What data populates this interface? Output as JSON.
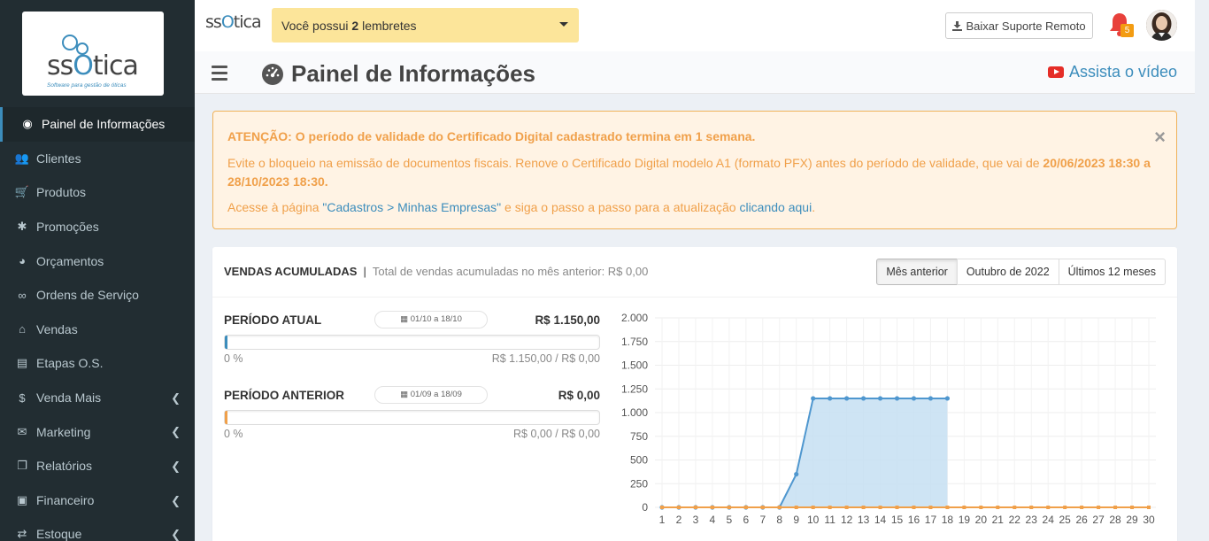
{
  "sidebar": {
    "logo": {
      "text_pre": "ss",
      "text_o": "O",
      "text_post": "tica",
      "tagline": "Software para gestão de óticas"
    },
    "items": [
      {
        "label": "Painel de Informações",
        "icon": "dashboard-icon",
        "active": true
      },
      {
        "label": "Clientes",
        "icon": "users-icon"
      },
      {
        "label": "Produtos",
        "icon": "cart-icon"
      },
      {
        "label": "Promoções",
        "icon": "asterisk-icon"
      },
      {
        "label": "Orçamentos",
        "icon": "user-circle-icon"
      },
      {
        "label": "Ordens de Serviço",
        "icon": "glasses-icon"
      },
      {
        "label": "Vendas",
        "icon": "basket-icon"
      },
      {
        "label": "Etapas O.S.",
        "icon": "list-icon"
      },
      {
        "label": "Venda Mais",
        "icon": "dollar-icon",
        "submenu": true
      },
      {
        "label": "Marketing",
        "icon": "comments-icon",
        "submenu": true
      },
      {
        "label": "Relatórios",
        "icon": "copy-icon",
        "submenu": true
      },
      {
        "label": "Financeiro",
        "icon": "money-icon",
        "submenu": true
      },
      {
        "label": "Estoque",
        "icon": "exchange-icon",
        "submenu": true
      }
    ]
  },
  "topbar": {
    "logo": {
      "text_pre": "ss",
      "text_o": "O",
      "text_post": "tica"
    },
    "reminder": {
      "prefix": "Você possui ",
      "count": "2",
      "suffix": " lembretes"
    },
    "support_button": "Baixar Suporte Remoto",
    "notifications_count": "5"
  },
  "header": {
    "title": "Painel de Informações",
    "video_link": "Assista o vídeo"
  },
  "alert": {
    "title": "ATENÇÃO: O período de validade do Certificado Digital cadastrado termina em 1 semana.",
    "body_prefix": "Evite o bloqueio na emissão de documentos fiscais. Renove o Certificado Digital modelo A1 (formato PFX) antes do período de validade, que vai de ",
    "body_dates": "20/06/2023 18:30 a 28/10/2023 18:30.",
    "line3_prefix": "Acesse à página ",
    "line3_page_link": "\"Cadastros > Minhas Empresas\"",
    "line3_middle": " e siga o passo a passo para a atualização ",
    "line3_click_link": "clicando aqui",
    "line3_suffix": ".",
    "close": "×"
  },
  "panel": {
    "title": "VENDAS ACUMULADAS",
    "separator": "|",
    "subtitle": "Total de vendas acumuladas no mês anterior: R$ 0,00",
    "range_buttons": [
      "Mês anterior",
      "Outubro de 2022",
      "Últimos 12 meses"
    ],
    "current": {
      "name": "PERÍODO ATUAL",
      "dates": "01/10 a 18/10",
      "value": "R$ 1.150,00",
      "percent": "0 %",
      "progress": 0.0,
      "ratio": "R$ 1.150,00 / R$ 0,00",
      "color": "#3c8dbc"
    },
    "previous": {
      "name": "PERÍODO ANTERIOR",
      "dates": "01/09 a 18/09",
      "value": "R$ 0,00",
      "percent": "0 %",
      "progress": 0.0,
      "ratio": "R$ 0,00 / R$ 0,00",
      "color": "#f0a04a"
    }
  },
  "chart_data": {
    "type": "area",
    "x": [
      1,
      2,
      3,
      4,
      5,
      6,
      7,
      8,
      9,
      10,
      11,
      12,
      13,
      14,
      15,
      16,
      17,
      18,
      19,
      20,
      21,
      22,
      23,
      24,
      25,
      26,
      27,
      28,
      29,
      30
    ],
    "series": [
      {
        "values": [
          0,
          0,
          0,
          0,
          0,
          0,
          0,
          0,
          350,
          1150,
          1150,
          1150,
          1150,
          1150,
          1150,
          1150,
          1150,
          1150
        ],
        "color": "#4f97cf",
        "fill": "#c6dff2"
      },
      {
        "values": [
          0,
          0,
          0,
          0,
          0,
          0,
          0,
          0,
          0,
          0,
          0,
          0,
          0,
          0,
          0,
          0,
          0,
          0,
          0,
          0,
          0,
          0,
          0,
          0,
          0,
          0,
          0,
          0,
          0,
          0
        ],
        "color": "#f0a04a"
      }
    ],
    "ylim": [
      0,
      2000
    ],
    "yticks": [
      "0",
      "250",
      "500",
      "750",
      "1.000",
      "1.250",
      "1.500",
      "1.750",
      "2.000"
    ],
    "grid": true
  }
}
